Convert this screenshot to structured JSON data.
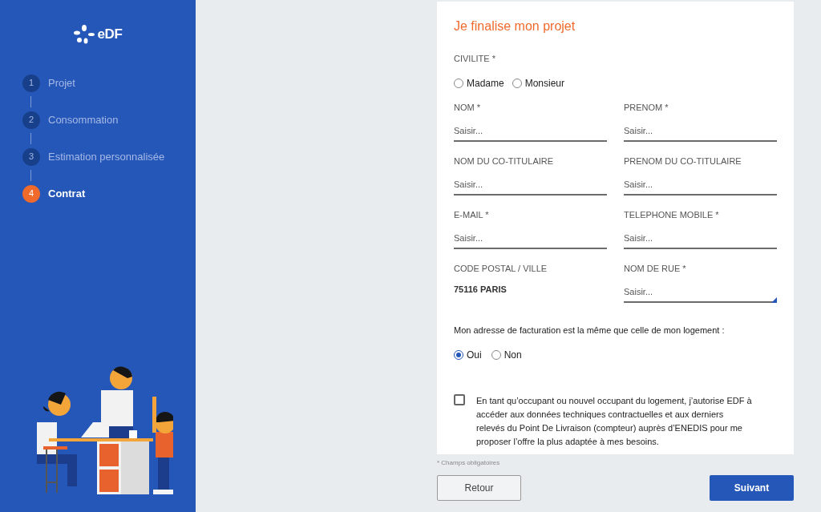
{
  "logo": {
    "text": "eDF"
  },
  "steps": [
    {
      "number": "1",
      "label": "Projet",
      "selected": false
    },
    {
      "number": "2",
      "label": "Consommation",
      "selected": false
    },
    {
      "number": "3",
      "label": "Estimation personnalisée",
      "selected": false
    },
    {
      "number": "4",
      "label": "Contrat",
      "selected": true
    }
  ],
  "form": {
    "title": "Je finalise mon projet",
    "civilite": {
      "label": "CIVILITE *",
      "options": [
        {
          "label": "Madame",
          "selected": false
        },
        {
          "label": "Monsieur",
          "selected": false
        }
      ]
    },
    "fields": [
      {
        "kind": "input",
        "label": "NOM *",
        "placeholder": "Saisir..."
      },
      {
        "kind": "input",
        "label": "PRENOM *",
        "placeholder": "Saisir..."
      },
      {
        "kind": "input",
        "label": "NOM DU CO-TITULAIRE",
        "placeholder": "Saisir..."
      },
      {
        "kind": "input",
        "label": "PRENOM DU CO-TITULAIRE",
        "placeholder": "Saisir..."
      },
      {
        "kind": "input",
        "label": "E-MAIL *",
        "placeholder": "Saisir..."
      },
      {
        "kind": "input",
        "label": "TELEPHONE MOBILE *",
        "placeholder": "Saisir..."
      },
      {
        "kind": "static",
        "label": "CODE POSTAL / VILLE",
        "value": "75116 PARIS"
      },
      {
        "kind": "autocomplete",
        "label": "NOM DE RUE *",
        "placeholder": "Saisir..."
      }
    ],
    "billing": {
      "question": "Mon adresse de facturation est la même que celle de mon logement :",
      "options": [
        {
          "label": "Oui",
          "selected": true
        },
        {
          "label": "Non",
          "selected": false
        }
      ]
    },
    "consent": {
      "checked": false,
      "text": "En tant qu’occupant ou nouvel occupant du logement, j’autorise EDF à accéder aux données techniques contractuelles et aux derniers relevés du Point De Livraison (compteur) auprès d’ENEDIS pour me proposer l’offre la plus adaptée à mes besoins."
    }
  },
  "required_note": "* Champs obligatoires",
  "buttons": {
    "back": "Retour",
    "next": "Suivant"
  }
}
